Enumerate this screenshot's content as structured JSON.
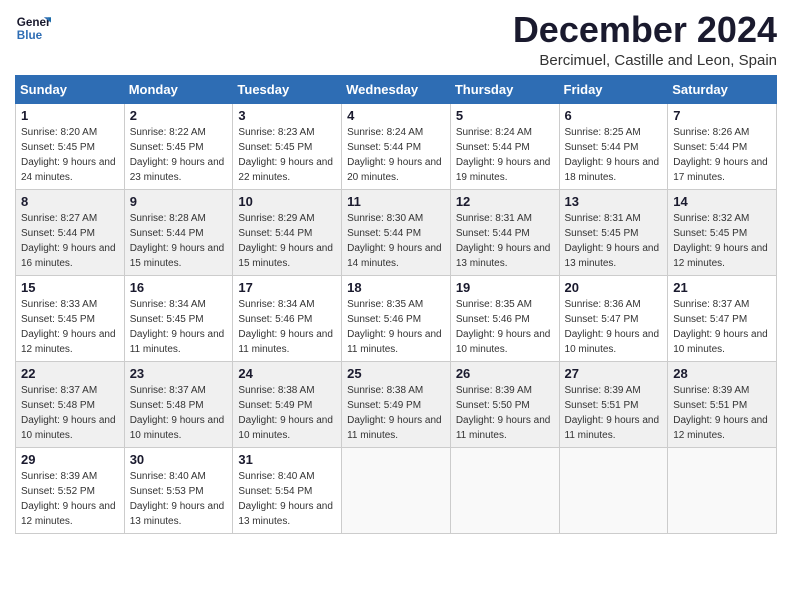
{
  "logo": {
    "line1": "General",
    "line2": "Blue"
  },
  "title": "December 2024",
  "location": "Bercimuel, Castille and Leon, Spain",
  "days_of_week": [
    "Sunday",
    "Monday",
    "Tuesday",
    "Wednesday",
    "Thursday",
    "Friday",
    "Saturday"
  ],
  "weeks": [
    [
      {
        "day": "1",
        "sunrise": "Sunrise: 8:20 AM",
        "sunset": "Sunset: 5:45 PM",
        "daylight": "Daylight: 9 hours and 24 minutes."
      },
      {
        "day": "2",
        "sunrise": "Sunrise: 8:22 AM",
        "sunset": "Sunset: 5:45 PM",
        "daylight": "Daylight: 9 hours and 23 minutes."
      },
      {
        "day": "3",
        "sunrise": "Sunrise: 8:23 AM",
        "sunset": "Sunset: 5:45 PM",
        "daylight": "Daylight: 9 hours and 22 minutes."
      },
      {
        "day": "4",
        "sunrise": "Sunrise: 8:24 AM",
        "sunset": "Sunset: 5:44 PM",
        "daylight": "Daylight: 9 hours and 20 minutes."
      },
      {
        "day": "5",
        "sunrise": "Sunrise: 8:24 AM",
        "sunset": "Sunset: 5:44 PM",
        "daylight": "Daylight: 9 hours and 19 minutes."
      },
      {
        "day": "6",
        "sunrise": "Sunrise: 8:25 AM",
        "sunset": "Sunset: 5:44 PM",
        "daylight": "Daylight: 9 hours and 18 minutes."
      },
      {
        "day": "7",
        "sunrise": "Sunrise: 8:26 AM",
        "sunset": "Sunset: 5:44 PM",
        "daylight": "Daylight: 9 hours and 17 minutes."
      }
    ],
    [
      {
        "day": "8",
        "sunrise": "Sunrise: 8:27 AM",
        "sunset": "Sunset: 5:44 PM",
        "daylight": "Daylight: 9 hours and 16 minutes."
      },
      {
        "day": "9",
        "sunrise": "Sunrise: 8:28 AM",
        "sunset": "Sunset: 5:44 PM",
        "daylight": "Daylight: 9 hours and 15 minutes."
      },
      {
        "day": "10",
        "sunrise": "Sunrise: 8:29 AM",
        "sunset": "Sunset: 5:44 PM",
        "daylight": "Daylight: 9 hours and 15 minutes."
      },
      {
        "day": "11",
        "sunrise": "Sunrise: 8:30 AM",
        "sunset": "Sunset: 5:44 PM",
        "daylight": "Daylight: 9 hours and 14 minutes."
      },
      {
        "day": "12",
        "sunrise": "Sunrise: 8:31 AM",
        "sunset": "Sunset: 5:44 PM",
        "daylight": "Daylight: 9 hours and 13 minutes."
      },
      {
        "day": "13",
        "sunrise": "Sunrise: 8:31 AM",
        "sunset": "Sunset: 5:45 PM",
        "daylight": "Daylight: 9 hours and 13 minutes."
      },
      {
        "day": "14",
        "sunrise": "Sunrise: 8:32 AM",
        "sunset": "Sunset: 5:45 PM",
        "daylight": "Daylight: 9 hours and 12 minutes."
      }
    ],
    [
      {
        "day": "15",
        "sunrise": "Sunrise: 8:33 AM",
        "sunset": "Sunset: 5:45 PM",
        "daylight": "Daylight: 9 hours and 12 minutes."
      },
      {
        "day": "16",
        "sunrise": "Sunrise: 8:34 AM",
        "sunset": "Sunset: 5:45 PM",
        "daylight": "Daylight: 9 hours and 11 minutes."
      },
      {
        "day": "17",
        "sunrise": "Sunrise: 8:34 AM",
        "sunset": "Sunset: 5:46 PM",
        "daylight": "Daylight: 9 hours and 11 minutes."
      },
      {
        "day": "18",
        "sunrise": "Sunrise: 8:35 AM",
        "sunset": "Sunset: 5:46 PM",
        "daylight": "Daylight: 9 hours and 11 minutes."
      },
      {
        "day": "19",
        "sunrise": "Sunrise: 8:35 AM",
        "sunset": "Sunset: 5:46 PM",
        "daylight": "Daylight: 9 hours and 10 minutes."
      },
      {
        "day": "20",
        "sunrise": "Sunrise: 8:36 AM",
        "sunset": "Sunset: 5:47 PM",
        "daylight": "Daylight: 9 hours and 10 minutes."
      },
      {
        "day": "21",
        "sunrise": "Sunrise: 8:37 AM",
        "sunset": "Sunset: 5:47 PM",
        "daylight": "Daylight: 9 hours and 10 minutes."
      }
    ],
    [
      {
        "day": "22",
        "sunrise": "Sunrise: 8:37 AM",
        "sunset": "Sunset: 5:48 PM",
        "daylight": "Daylight: 9 hours and 10 minutes."
      },
      {
        "day": "23",
        "sunrise": "Sunrise: 8:37 AM",
        "sunset": "Sunset: 5:48 PM",
        "daylight": "Daylight: 9 hours and 10 minutes."
      },
      {
        "day": "24",
        "sunrise": "Sunrise: 8:38 AM",
        "sunset": "Sunset: 5:49 PM",
        "daylight": "Daylight: 9 hours and 10 minutes."
      },
      {
        "day": "25",
        "sunrise": "Sunrise: 8:38 AM",
        "sunset": "Sunset: 5:49 PM",
        "daylight": "Daylight: 9 hours and 11 minutes."
      },
      {
        "day": "26",
        "sunrise": "Sunrise: 8:39 AM",
        "sunset": "Sunset: 5:50 PM",
        "daylight": "Daylight: 9 hours and 11 minutes."
      },
      {
        "day": "27",
        "sunrise": "Sunrise: 8:39 AM",
        "sunset": "Sunset: 5:51 PM",
        "daylight": "Daylight: 9 hours and 11 minutes."
      },
      {
        "day": "28",
        "sunrise": "Sunrise: 8:39 AM",
        "sunset": "Sunset: 5:51 PM",
        "daylight": "Daylight: 9 hours and 12 minutes."
      }
    ],
    [
      {
        "day": "29",
        "sunrise": "Sunrise: 8:39 AM",
        "sunset": "Sunset: 5:52 PM",
        "daylight": "Daylight: 9 hours and 12 minutes."
      },
      {
        "day": "30",
        "sunrise": "Sunrise: 8:40 AM",
        "sunset": "Sunset: 5:53 PM",
        "daylight": "Daylight: 9 hours and 13 minutes."
      },
      {
        "day": "31",
        "sunrise": "Sunrise: 8:40 AM",
        "sunset": "Sunset: 5:54 PM",
        "daylight": "Daylight: 9 hours and 13 minutes."
      },
      null,
      null,
      null,
      null
    ]
  ]
}
